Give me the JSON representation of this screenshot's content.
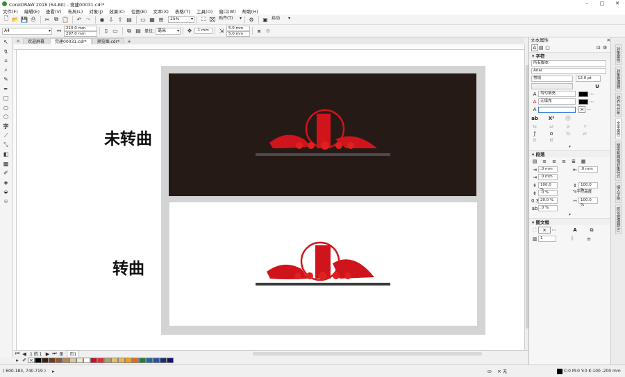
{
  "title": "CorelDRAW 2018 (64-Bit) - 党建00031.cdr*",
  "window_controls": [
    "–",
    "□",
    "✕"
  ],
  "menu": [
    "文件(F)",
    "编辑(E)",
    "查看(V)",
    "布局(L)",
    "对象(J)",
    "效果(C)",
    "位图(B)",
    "文本(X)",
    "表格(T)",
    "工具(O)",
    "窗口(W)",
    "帮助(H)"
  ],
  "toolbar": {
    "zoom": "25%",
    "snap": "贴齐(T)",
    "launch": "启动"
  },
  "propbar": {
    "page_size": "A4",
    "width": "210.0 mm",
    "height": "297.0 mm",
    "unit_label": "单位:",
    "unit": "毫米",
    "nudge": ".1 mm",
    "dup_x": "5.0 mm",
    "dup_y": "5.0 mm"
  },
  "tabs": [
    "欢迎屏幕",
    "党建00031.cdr*",
    "预览图.cdr*"
  ],
  "canvas": {
    "label_top": "未转曲",
    "label_bottom": "转曲",
    "accent": "#d0141b",
    "dark_bg": "#261a17"
  },
  "page_nav": {
    "pos": "1 的 1",
    "page": "页1"
  },
  "palette": [
    "#000000",
    "#3b1d14",
    "#6b3a1f",
    "#8a5a32",
    "#b08a5a",
    "#d8c8a8",
    "#f2e8d0",
    "#ffffff",
    "#c8102e",
    "#e03030",
    "#b3a06b",
    "#d9c27a",
    "#e7b84a",
    "#f0a020",
    "#e86820",
    "#2a7a3a",
    "#1e6a9e",
    "#3050a0",
    "#1a2f70",
    "#14146a"
  ],
  "status": {
    "coords": "( 600.183, 740.719 )",
    "fill_none": "无",
    "fill_info": "C:0 M:0 Y:0 K:100 .200 mm"
  },
  "docker": {
    "title": "文本属性",
    "char_section": "字符",
    "script": "所有脚本",
    "font": "Arial",
    "style": "常规",
    "size": "12.0 pt",
    "fill1": "均匀填充",
    "fill2": "无填充",
    "para_section": "段落",
    "indent1": ".0 mm",
    "indent2": ".0 mm",
    "indent3": ".0 mm",
    "spacing1": "100.0 %",
    "spacing2": "100.0 %",
    "spacing3": ".0 %",
    "spacing_mode": "%字符高度",
    "spacing4": "20.0 %",
    "spacing5": "100.0 %",
    "spacing6": ".0 %",
    "frame_section": "图文框",
    "columns": "1"
  },
  "side_tabs": [
    "对象属性",
    "对象管理器",
    "对齐与分布",
    "文本属性",
    "图形和网格对象样式",
    "插入字符",
    "符号管理器(S)"
  ]
}
